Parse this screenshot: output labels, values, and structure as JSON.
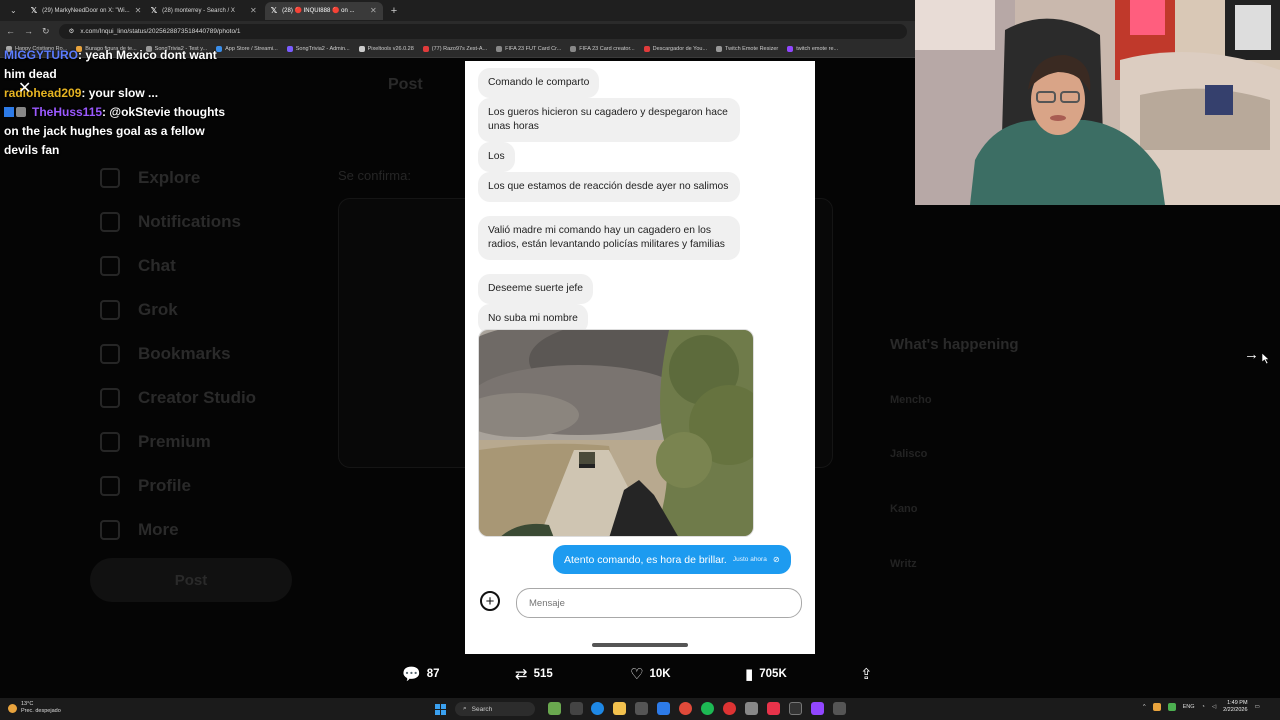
{
  "browser": {
    "tabs": [
      {
        "label": "(29) MarkyNeedDoor on X: \"Wi...",
        "active": false
      },
      {
        "label": "(28) monterrey - Search / X",
        "active": false
      },
      {
        "label": "(28) 🔴 INQUI888 🔴 on ...",
        "active": true
      }
    ],
    "url": "x.com/Inqui_lino/status/2025628873518440789/photo/1",
    "bookmarks": [
      "Happy Cristiano Ro...",
      "Burago figura de te...",
      "SongTrivia2 - Test y...",
      "App Store / Streami...",
      "SongTrivia2 - Admin...",
      "Pixeltools v26.0.28",
      "(77) Razo97s Zest-A...",
      "FIFA 23 FUT Card Cr...",
      "FIFA 23 Card creator...",
      "Descargador de You...",
      "Twitch Emote Resizer",
      "twitch emote re..."
    ]
  },
  "chat": [
    {
      "user": "MIGGYTURO",
      "user_color": "#5b7cff",
      "text": ": yeah Mexico dont want him dead"
    },
    {
      "user": "radiohead209",
      "user_color": "#e6b422",
      "text": ": your slow ..."
    },
    {
      "user": "TheHuss115",
      "user_color": "#9b59ff",
      "text": ": @okStevie thoughts on the jack hughes goal as a fellow devils fan"
    }
  ],
  "messages": [
    "Comando le comparto",
    "Los gueros hicieron su cagadero y despegaron hace unas horas",
    "Los",
    "Los que estamos de reacción desde ayer no salimos",
    "Valió madre mi comando hay un cagadero en los radios, están levantando policías militares y familias",
    "Deseeme suerte jefe",
    "No suba mi nombre"
  ],
  "sent_message": {
    "text": "Atento comando, es hora de brillar.",
    "time": "Justo ahora"
  },
  "input": {
    "placeholder": "Mensaje"
  },
  "stats": {
    "replies": "87",
    "reposts": "515",
    "likes": "10K",
    "views": "705K"
  },
  "background_page": {
    "nav": [
      "Explore",
      "Notifications",
      "Chat",
      "Grok",
      "Bookmarks",
      "Creator Studio",
      "Premium",
      "Profile",
      "More"
    ],
    "post_button": "Post",
    "header": "Post",
    "post_text": "Se confirma:",
    "whats_happening": "What's happening",
    "trends": [
      "Mencho",
      "Jalisco",
      "Kano",
      "Writz"
    ]
  },
  "taskbar": {
    "weather_temp": "13°C",
    "weather_desc": "Prec. despejado",
    "search": "Search",
    "lang": "ENG",
    "time": "1:49 PM",
    "date": "2/22/2026"
  },
  "colors": {
    "accent": "#1d9bf0",
    "bubble": "#f0f0f0"
  }
}
